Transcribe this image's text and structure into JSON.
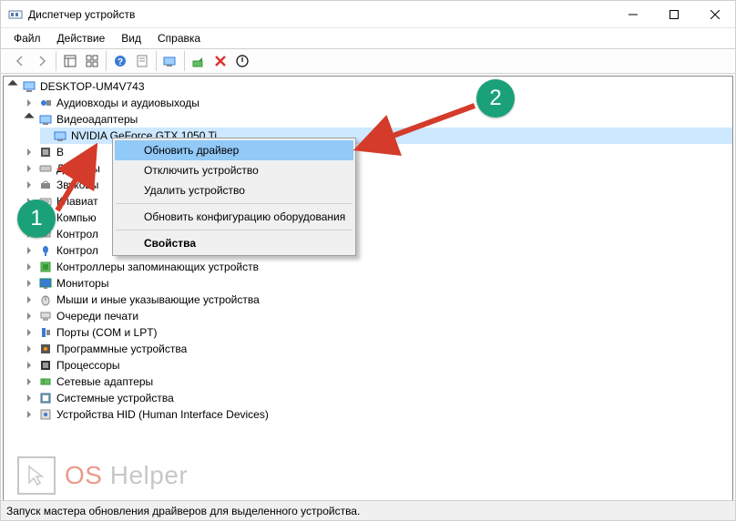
{
  "window": {
    "title": "Диспетчер устройств"
  },
  "menu": {
    "file": "Файл",
    "action": "Действие",
    "view": "Вид",
    "help": "Справка"
  },
  "tree": {
    "root": "DESKTOP-UM4V743",
    "items": [
      "Аудиовходы и аудиовыходы",
      "Видеоадаптеры",
      "Встроенное ПО",
      "Дисковые устройства",
      "Звуковые, игровые и видео...",
      "Клавиатуры",
      "Компьютер",
      "Контроллеры IDE ATA/ATAPI",
      "Контроллеры USB",
      "Контроллеры запоминающих устройств",
      "Мониторы",
      "Мыши и иные указывающие устройства",
      "Очереди печати",
      "Порты (COM и LPT)",
      "Программные устройства",
      "Процессоры",
      "Сетевые адаптеры",
      "Системные устройства",
      "Устройства HID (Human Interface Devices)"
    ],
    "items_truncated": {
      "2": "В",
      "3": "Дисковы",
      "4": "Звуковы",
      "5": "Клавиат",
      "6": "Компью",
      "7": "Контрол",
      "8": "Контрол"
    },
    "gpu": "NVIDIA GeForce GTX 1050 Ti"
  },
  "context_menu": {
    "items": [
      "Обновить драйвер",
      "Отключить устройство",
      "Удалить устройство",
      "Обновить конфигурацию оборудования",
      "Свойства"
    ]
  },
  "status": "Запуск мастера обновления драйверов для выделенного устройства.",
  "annotations": {
    "badge1": "1",
    "badge2": "2"
  },
  "watermark": {
    "os": "OS",
    "helper": " Helper"
  }
}
